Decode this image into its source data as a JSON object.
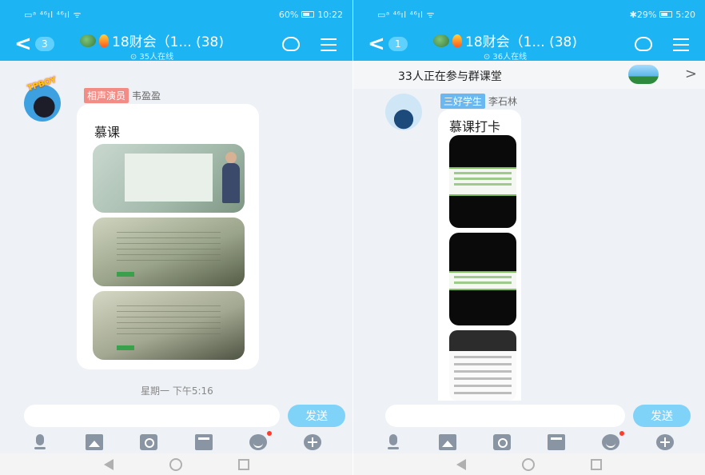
{
  "left": {
    "status": {
      "left": "▭ᵃ ⁴⁶ıl ⁴⁶ıl ᯤ",
      "battery": "60%",
      "time": "10:22"
    },
    "header": {
      "unread": "3",
      "title": "18财会（1... (38)",
      "online": "⊙ 35人在线"
    },
    "message": {
      "badge": "TPBOY",
      "role_tag": "相声演员",
      "sender": "韦盈盈",
      "text": "慕课"
    },
    "timestamp": "星期一 下午5:16",
    "input": {
      "placeholder": "",
      "send_label": "发送"
    }
  },
  "right": {
    "status": {
      "left": "▭ᵃ ⁴⁶ıl ⁴⁶ıl ᯤ",
      "battery": "✱29%",
      "time": "5:20"
    },
    "header": {
      "unread": "1",
      "title": "18财会（1... (38)",
      "online": "⊙ 36人在线"
    },
    "banner": {
      "text": "33人正在参与群课堂",
      "chevron": ">"
    },
    "message": {
      "role_tag": "三好学生",
      "sender": "李石林",
      "text": "慕课打卡"
    },
    "input": {
      "placeholder": "",
      "send_label": "发送"
    }
  },
  "icons": [
    "mic-icon",
    "image-icon",
    "camera-icon",
    "card-icon",
    "emoji-icon",
    "plus-icon"
  ],
  "colors": {
    "header": "#1cb4f3",
    "send": "#7fd3f8",
    "red_tag": "#f48c86",
    "blue_tag": "#6ab8ef"
  }
}
